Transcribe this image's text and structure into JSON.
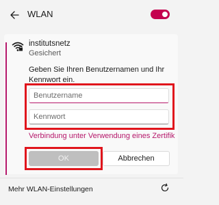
{
  "header": {
    "title": "WLAN",
    "back_icon": "back-arrow-icon",
    "toggle_state": "on"
  },
  "network": {
    "icon": "wifi-secure-icon",
    "name": "institutsnetz",
    "status": "Gesichert",
    "prompt": "Geben Sie Ihren Benutzernamen und Ihr Kennwort ein.",
    "username_value": "",
    "username_placeholder": "Benutzername",
    "password_value": "",
    "password_placeholder": "Kennwort",
    "certificate_link": "Verbindung unter Verwendung eines Zertifik",
    "ok_label": "OK",
    "cancel_label": "Abbrechen"
  },
  "footer": {
    "settings_link": "Mehr WLAN-Einstellungen",
    "refresh_icon": "refresh-icon"
  },
  "colors": {
    "accent": "#b5176a",
    "toggle": "#c4004e",
    "highlight": "#e0151c"
  }
}
